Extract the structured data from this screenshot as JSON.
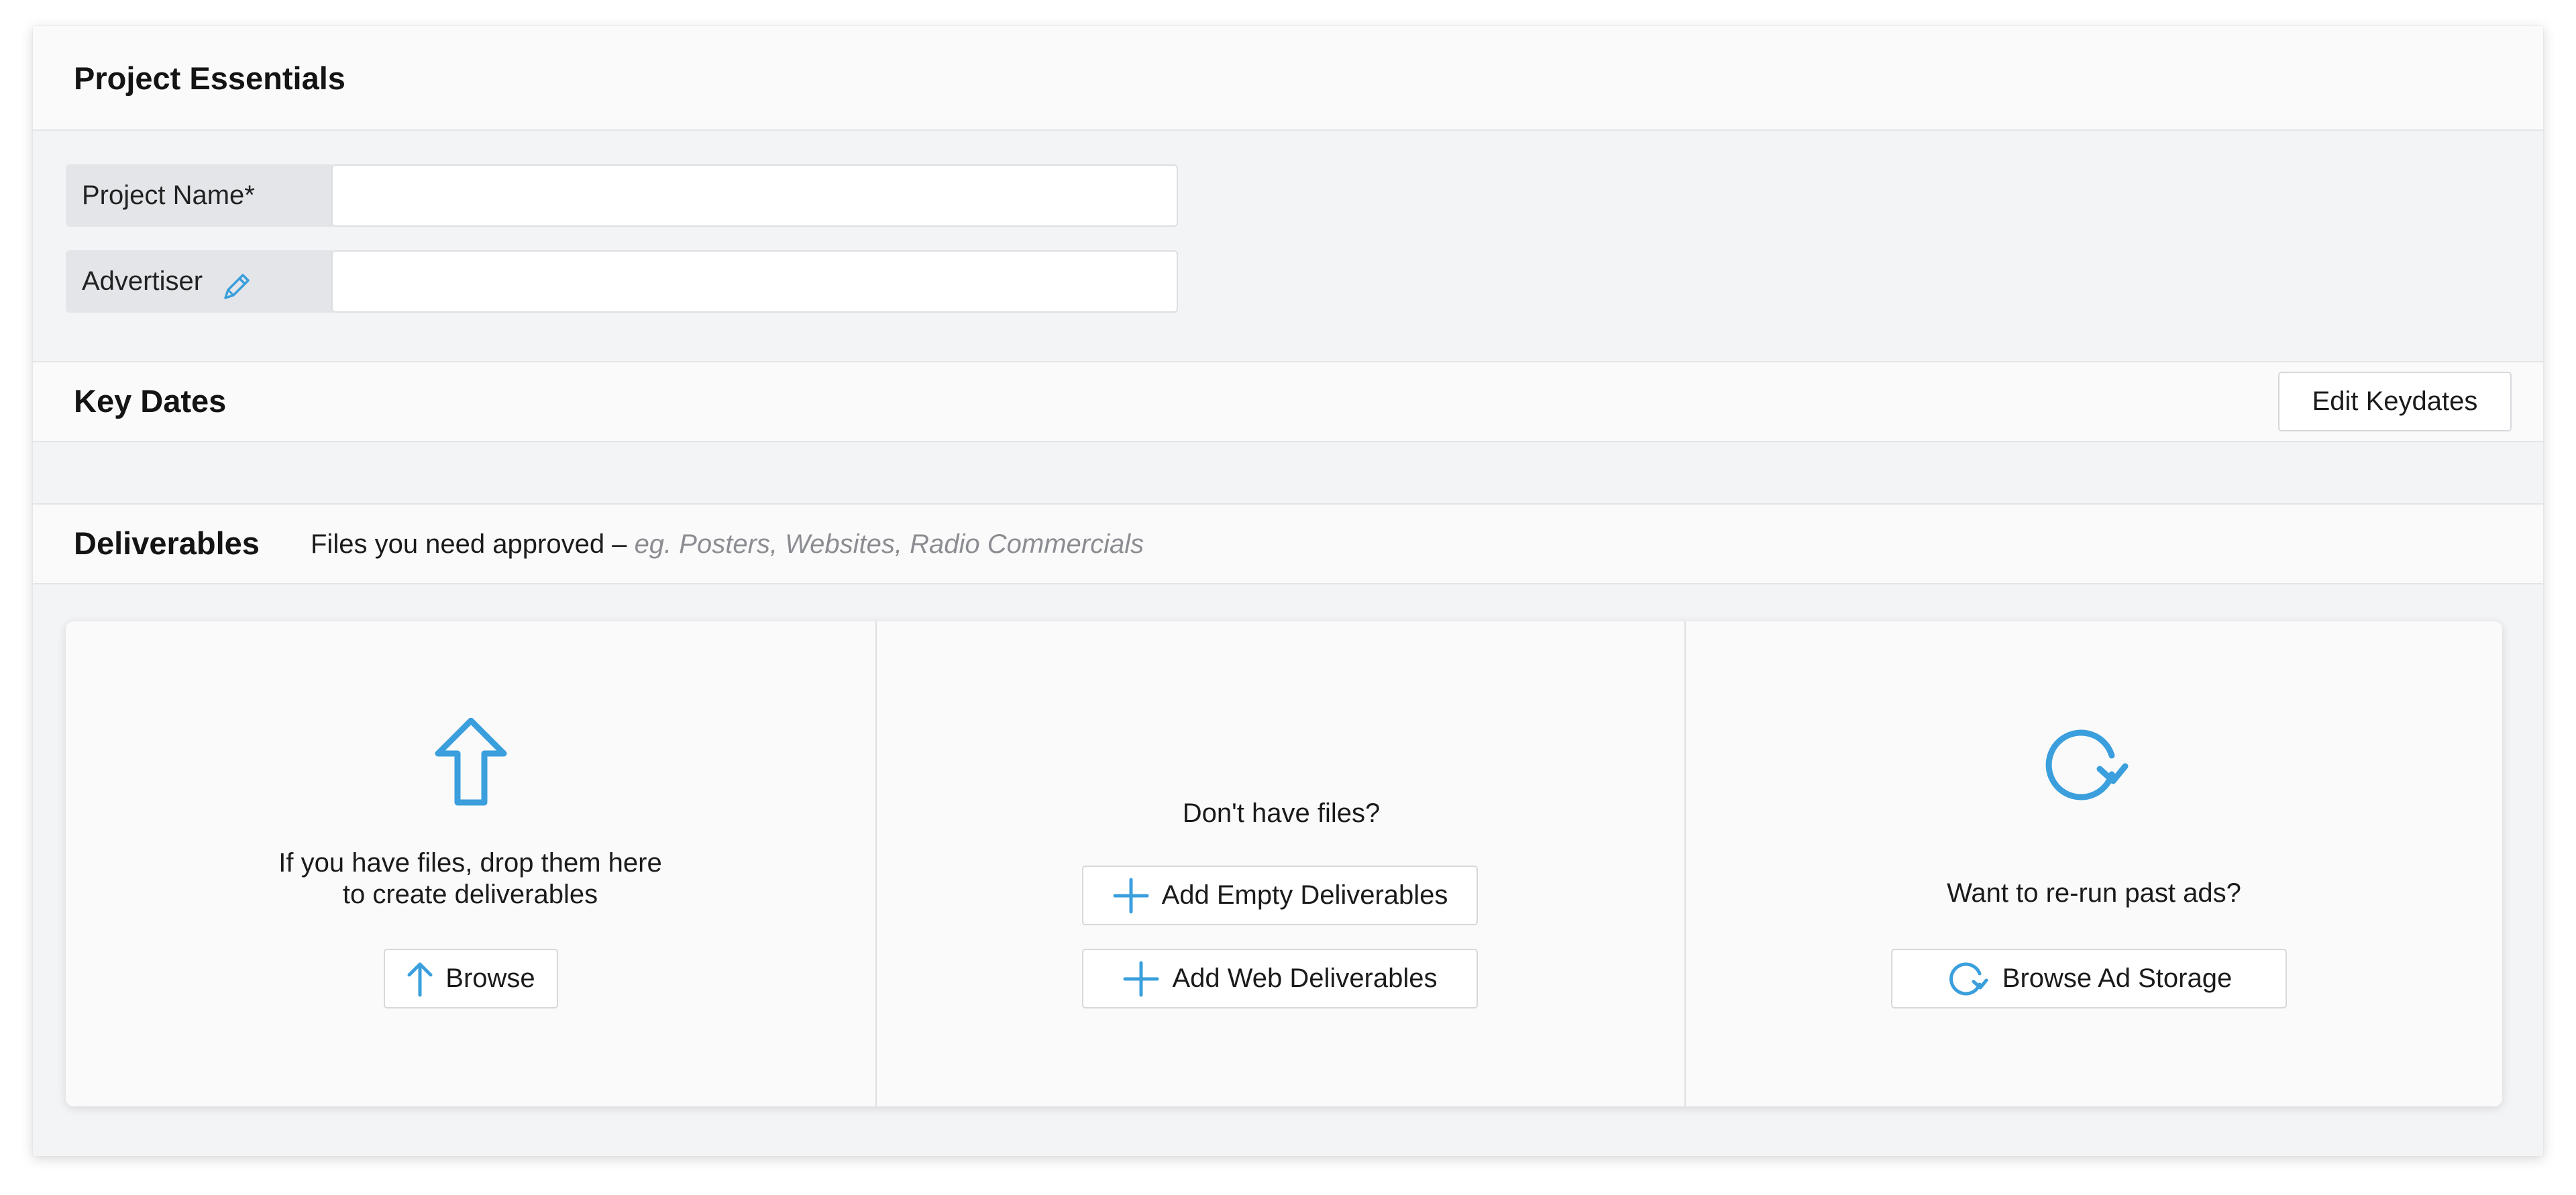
{
  "essentials": {
    "title": "Project Essentials",
    "project_name_label": "Project Name*",
    "project_name_value": "",
    "advertiser_label": "Advertiser",
    "advertiser_value": ""
  },
  "key_dates": {
    "title": "Key Dates",
    "edit_button": "Edit Keydates"
  },
  "deliverables": {
    "title": "Deliverables",
    "subtitle_main": "Files you need approved –",
    "subtitle_example": "eg. Posters, Websites, Radio Commercials",
    "upload_panel": {
      "icon": "upload-arrow-icon",
      "line1": "If you have files, drop them here",
      "line2": "to create deliverables",
      "button": "Browse"
    },
    "empty_panel": {
      "question": "Don't have files?",
      "add_empty_button": "Add Empty Deliverables",
      "add_web_button": "Add Web Deliverables"
    },
    "rerun_panel": {
      "icon": "refresh-icon",
      "question": "Want to re-run past ads?",
      "button": "Browse Ad Storage"
    }
  },
  "colors": {
    "accent": "#3a9fdc",
    "background": "#f3f4f6",
    "header_bg": "#fafafa",
    "label_bg": "#e3e5e9"
  }
}
